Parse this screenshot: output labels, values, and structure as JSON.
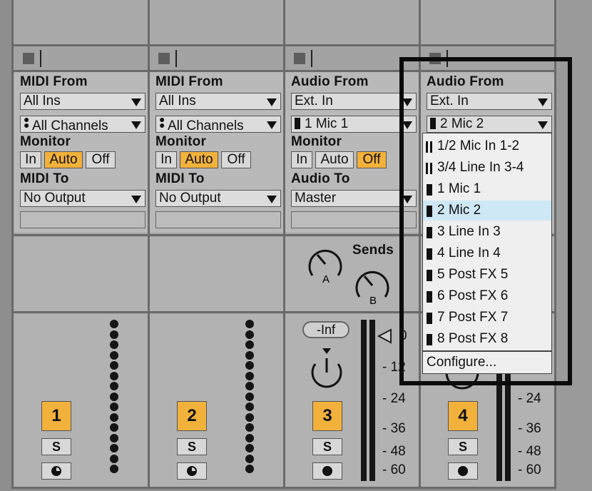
{
  "tracks": [
    {
      "number": "1",
      "io_label": "MIDI From",
      "source": "All Ins",
      "channel": "All Channels",
      "channel_icon": "midi-channel-dots",
      "monitor": "Auto",
      "out_label": "MIDI To",
      "out": "No Output",
      "solo": "S",
      "arm_icon": "circle-half"
    },
    {
      "number": "2",
      "io_label": "MIDI From",
      "source": "All Ins",
      "channel": "All Channels",
      "channel_icon": "midi-channel-dots",
      "monitor": "Auto",
      "out_label": "MIDI To",
      "out": "No Output",
      "solo": "S",
      "arm_icon": "circle-half"
    },
    {
      "number": "3",
      "io_label": "Audio From",
      "source": "Ext. In",
      "channel": "1 Mic 1",
      "channel_icon": "mono-bar",
      "monitor": "Off",
      "out_label": "Audio To",
      "out": "Master",
      "solo": "S",
      "arm_icon": "record-dot"
    },
    {
      "number": "4",
      "io_label": "Audio From",
      "source": "Ext. In",
      "channel": "2 Mic 2",
      "channel_icon": "mono-bar",
      "monitor": "",
      "out_label": "",
      "out": "",
      "solo": "S",
      "arm_icon": "record-dot"
    }
  ],
  "monitor_labels": {
    "title": "Monitor",
    "in": "In",
    "auto": "Auto",
    "off": "Off"
  },
  "sends": {
    "title": "Sends",
    "a": "A",
    "b": "B"
  },
  "volume": {
    "value": "-Inf"
  },
  "meter_scale": [
    "0",
    "12",
    "24",
    "36",
    "48",
    "60"
  ],
  "meter_scale_right": [
    "24",
    "36",
    "48",
    "60"
  ],
  "input_menu": {
    "options": [
      {
        "label": "1/2 Mic In 1-2",
        "icon": "stereo-bar",
        "selected": false
      },
      {
        "label": "3/4 Line In 3-4",
        "icon": "stereo-bar",
        "selected": false
      },
      {
        "label": "1 Mic 1",
        "icon": "mono-bar",
        "selected": false
      },
      {
        "label": "2 Mic 2",
        "icon": "mono-bar",
        "selected": true
      },
      {
        "label": "3 Line In 3",
        "icon": "mono-bar",
        "selected": false
      },
      {
        "label": "4 Line In 4",
        "icon": "mono-bar",
        "selected": false
      },
      {
        "label": "5 Post FX 5",
        "icon": "mono-bar",
        "selected": false
      },
      {
        "label": "6 Post FX 6",
        "icon": "mono-bar",
        "selected": false
      },
      {
        "label": "7 Post FX 7",
        "icon": "mono-bar",
        "selected": false
      },
      {
        "label": "8 Post FX 8",
        "icon": "mono-bar",
        "selected": false
      }
    ],
    "configure": "Configure..."
  },
  "colors": {
    "accent": "#f2b13b",
    "selection": "#cfe8f6",
    "panel": "#b9b9b9",
    "highlight_border": "#0b0b0b"
  }
}
